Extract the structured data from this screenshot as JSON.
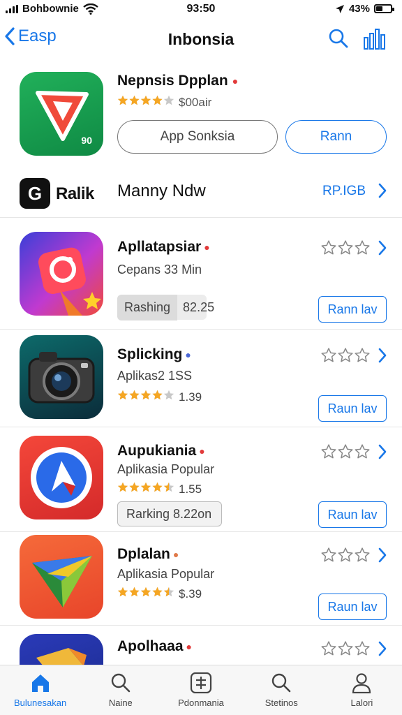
{
  "status_bar": {
    "carrier": "Bohbownie",
    "time": "93:50",
    "battery": "43%",
    "battery_level": 0.43
  },
  "nav": {
    "back_label": "Easp",
    "title": "Inbonsia"
  },
  "featured": {
    "name": "Nepnsis Dpplan",
    "icon_badge": "90",
    "rating": 4,
    "rating_text": "$00air",
    "secondary_button": "App Sonksia",
    "primary_button": "Rann"
  },
  "publisher": {
    "logo": "G",
    "name": "Ralik",
    "label": "Manny Ndw",
    "action": "RP.IGB"
  },
  "apps": [
    {
      "name": "Apllatapsiar",
      "dot_color": "#e23a3a",
      "subtitle": "Cepans 33 Min",
      "rank": "Rashing",
      "rank_value": "82.25",
      "button": "Rann lav",
      "stars": 0
    },
    {
      "name": "Splicking",
      "dot_color": "#4a67d6",
      "subtitle": "Aplikas2 1SS",
      "rating": 4,
      "rating_text": "1.39",
      "button": "Raun lav",
      "stars": 0
    },
    {
      "name": "Aupukiania",
      "dot_color": "#e23a3a",
      "subtitle": "Aplikasia Popular",
      "rating": 4.5,
      "rating_text": "1.55",
      "rank": "Rarking",
      "rank_value": "8.22on",
      "button": "Raun lav",
      "stars": 0
    },
    {
      "name": "Dplalan",
      "dot_color": "#e07a4a",
      "subtitle": "Aplikasia Popular",
      "rating": 4.5,
      "rating_text": "$.39",
      "button": "Raun lav",
      "stars": 0
    },
    {
      "name": "Apolhaaa",
      "dot_color": "#e23a3a",
      "stars": 0
    }
  ],
  "tabs": [
    {
      "label": "Bulunesakan",
      "icon": "home-icon",
      "active": true
    },
    {
      "label": "Naine",
      "icon": "search-icon",
      "active": false
    },
    {
      "label": "Pdonmania",
      "icon": "apps-icon",
      "active": false
    },
    {
      "label": "Stetinos",
      "icon": "search-icon",
      "active": false
    },
    {
      "label": "Lalori",
      "icon": "person-icon",
      "active": false
    }
  ],
  "colors": {
    "accent": "#1877e8",
    "star": "#f5a623"
  }
}
